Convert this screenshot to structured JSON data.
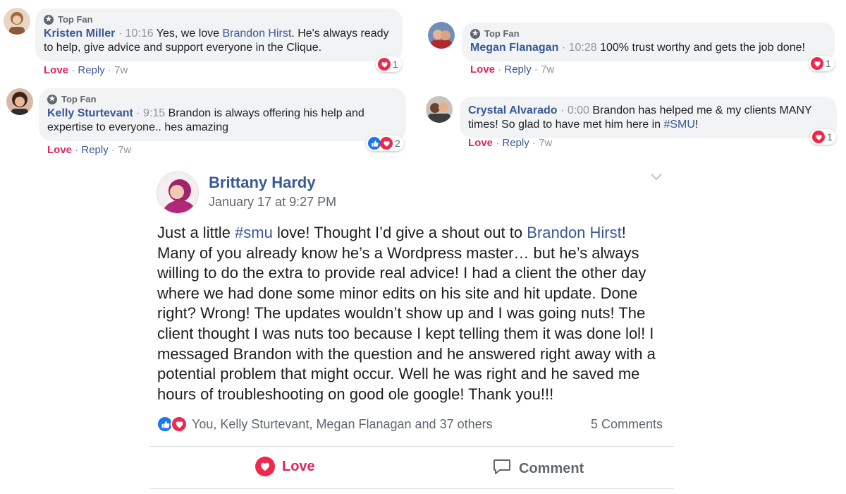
{
  "comments": [
    {
      "top_fan_label": "Top Fan",
      "author": "Kristen Miller",
      "time": "10:16",
      "text_before": "Yes, we love ",
      "link": "Brandon Hirst",
      "text_after": ". He's always ready to help, give advice and support everyone in the Clique.",
      "reaction_count": "1",
      "love_label": "Love",
      "reply_label": "Reply",
      "age": "7w"
    },
    {
      "top_fan_label": "Top Fan",
      "author": "Kelly Sturtevant",
      "time": "9:15",
      "text": "Brandon is always offering his help and expertise to everyone.. hes amazing",
      "reaction_count": "2",
      "love_label": "Love",
      "reply_label": "Reply",
      "age": "7w"
    },
    {
      "top_fan_label": "Top Fan",
      "author": "Megan Flanagan",
      "time": "10:28",
      "text": "100% trust worthy and gets the job done!",
      "reaction_count": "1",
      "love_label": "Love",
      "reply_label": "Reply",
      "age": "7w"
    },
    {
      "author": "Crystal Alvarado",
      "time": "0:00",
      "text_before": "Brandon has helped me & my clients MANY times! So glad to have met him here in ",
      "link": "#SMU",
      "text_after": "!",
      "reaction_count": "1",
      "love_label": "Love",
      "reply_label": "Reply",
      "age": "7w"
    }
  ],
  "post": {
    "author": "Brittany Hardy",
    "date": "January 17 at 9:27 PM",
    "body_1": "Just a little ",
    "hashtag": "#smu",
    "body_2": " love! Thought I’d give a shout out to ",
    "mention": "Brandon Hirst",
    "body_3": "! Many of you already know he’s a Wordpress master… but he’s always willing to do the extra to provide real advice! I had a client the other day where we had done some minor edits on his site and hit update. Done right? Wrong! The updates wouldn’t show up and I was going nuts! The client thought I was nuts too because I kept telling them it was done lol! I messaged Brandon with the question and he answered right away with a potential problem that might occur. Well he was right and he saved me hours of troubleshooting on good ole google! Thank you!!!",
    "reactions_text": "You, Kelly Sturtevant, Megan Flanagan and 37 others",
    "comments_count": "5 Comments",
    "love_button": "Love",
    "comment_button": "Comment"
  },
  "colors": {
    "link": "#385898",
    "love": "#e0245e",
    "heart": "#f0284a",
    "like": "#1877f2",
    "bubble": "#f2f3f5",
    "meta": "#90949c"
  },
  "icons": [
    "star-icon",
    "heart-icon",
    "like-icon",
    "chevron-down-icon",
    "comment-icon"
  ]
}
